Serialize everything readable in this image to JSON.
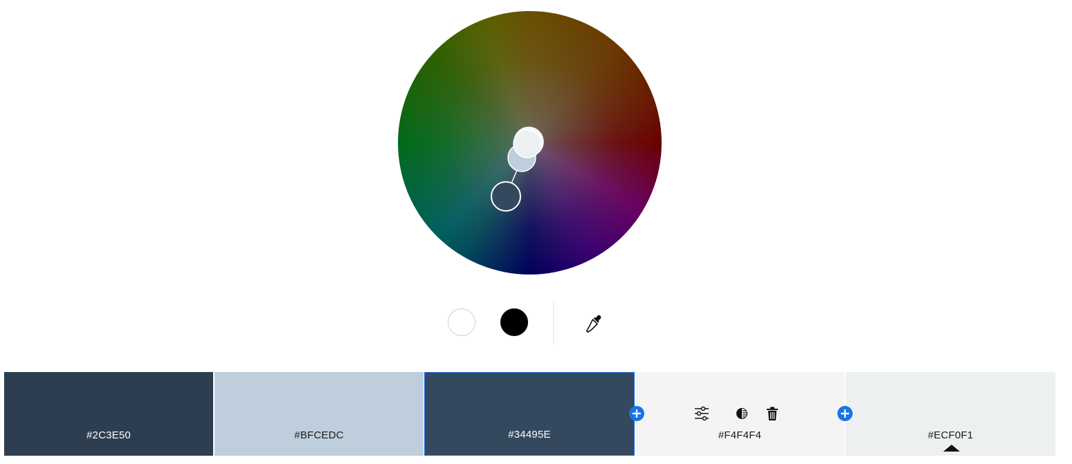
{
  "wheel": {
    "handles": [
      {
        "name": "color-handle-light",
        "color": "#ECF0F1"
      },
      {
        "name": "color-handle-lightgray",
        "color": "#F4F4F4"
      },
      {
        "name": "color-handle-blue-gray",
        "color": "#BFCEDC"
      },
      {
        "name": "color-handle-dark",
        "color": "#34495E"
      }
    ]
  },
  "tools": {
    "white_swatch_color": "#FFFFFF",
    "black_swatch_color": "#000000",
    "eyedropper_icon": "eyedropper-icon"
  },
  "palette": {
    "colors": [
      {
        "hex": "#2C3E50",
        "bg": "#2C3E50"
      },
      {
        "hex": "#BFCEDC",
        "bg": "#BFCEDC"
      },
      {
        "hex": "#34495E",
        "bg": "#34495E",
        "selected": true
      },
      {
        "hex": "#F4F4F4",
        "bg": "#F4F4F4"
      },
      {
        "hex": "#ECF0F1",
        "bg": "#ECF0F1"
      }
    ],
    "accent": "#1A73E8",
    "icons": [
      "plus-icon",
      "sliders-icon",
      "contrast-icon",
      "trash-icon",
      "caret-up-icon"
    ]
  }
}
